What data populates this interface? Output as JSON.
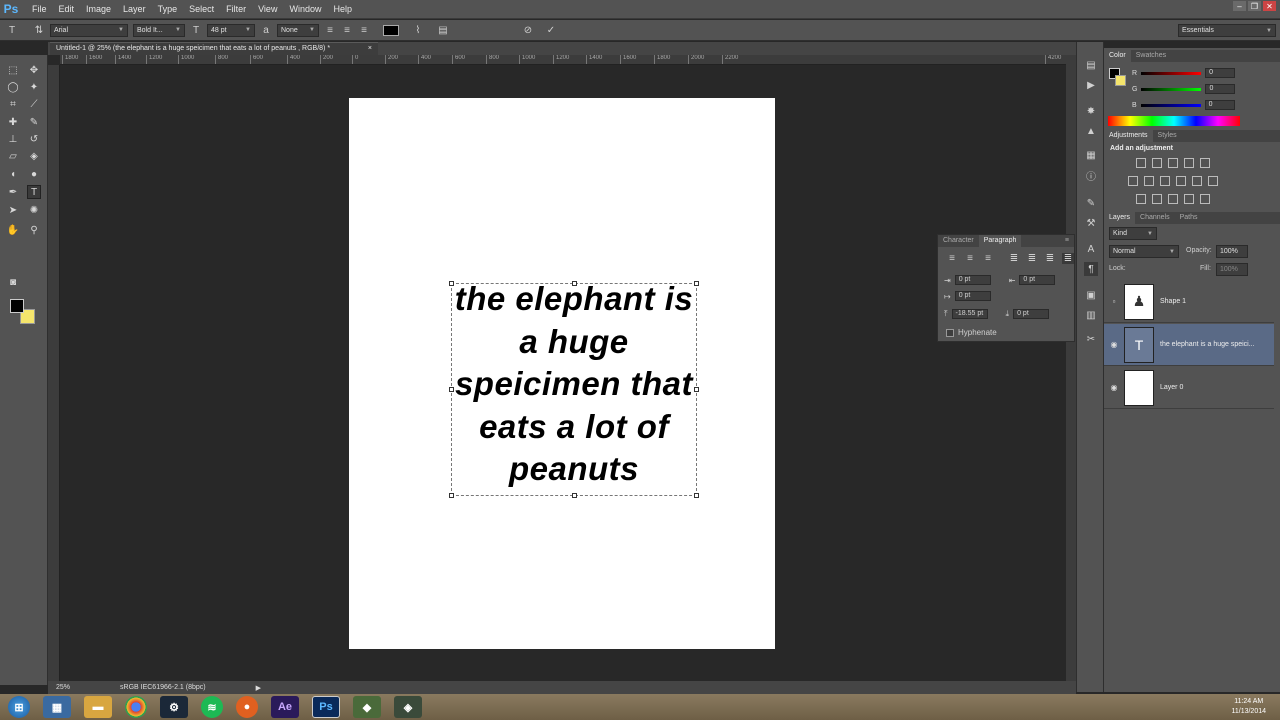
{
  "app": {
    "logo": "Ps"
  },
  "menu": [
    "File",
    "Edit",
    "Image",
    "Layer",
    "Type",
    "Select",
    "Filter",
    "View",
    "Window",
    "Help"
  ],
  "options": {
    "font_family": "Arial",
    "font_style": "Bold It...",
    "font_size": "48 pt",
    "anti_alias": "None",
    "workspace": "Essentials",
    "text_color": "#000000"
  },
  "document": {
    "tab_title": "Untitled-1 @ 25% (the elephant is a huge speicimen that  eats a lot of peanuts , RGB/8) *",
    "text_lines": [
      "the elephant is",
      "a huge",
      "speicimen that",
      "eats a lot of",
      "peanuts"
    ]
  },
  "ruler": [
    "1800",
    "1600",
    "1400",
    "1200",
    "1000",
    "800",
    "600",
    "400",
    "200",
    "0",
    "200",
    "400",
    "600",
    "800",
    "1000",
    "1200",
    "1400",
    "1600",
    "1800",
    "2000",
    "2200",
    "4200"
  ],
  "status": {
    "zoom": "25%",
    "profile": "sRGB IEC61966-2.1 (8bpc)"
  },
  "color_panel": {
    "tabs": [
      "Color",
      "Swatches"
    ],
    "channels": [
      {
        "label": "R",
        "value": "0",
        "color": "#e03030"
      },
      {
        "label": "G",
        "value": "0",
        "color": "#30c030"
      },
      {
        "label": "B",
        "value": "0",
        "color": "#3050e0"
      }
    ]
  },
  "adjustments_panel": {
    "tabs": [
      "Adjustments",
      "Styles"
    ],
    "heading": "Add an adjustment"
  },
  "layers_panel": {
    "tabs": [
      "Layers",
      "Channels",
      "Paths"
    ],
    "kind_label": "Kind",
    "blend_mode": "Normal",
    "opacity_label": "Opacity:",
    "opacity": "100%",
    "lock_label": "Lock:",
    "fill_label": "Fill:",
    "fill": "100%",
    "layers": [
      {
        "name": "Shape 1"
      },
      {
        "name": "the elephant is a huge speici..."
      },
      {
        "name": "Layer 0"
      }
    ]
  },
  "paragraph_panel": {
    "tabs": [
      "Character",
      "Paragraph"
    ],
    "indent_left": "0 pt",
    "indent_right": "0 pt",
    "indent_first": "0 pt",
    "space_before": "-18.55 pt",
    "space_after": "0 pt",
    "hyphenate_label": "Hyphenate"
  },
  "taskbar": {
    "time": "11:24 AM",
    "date": "11/13/2014",
    "ae_label": "Ae",
    "ps_label": "Ps"
  }
}
